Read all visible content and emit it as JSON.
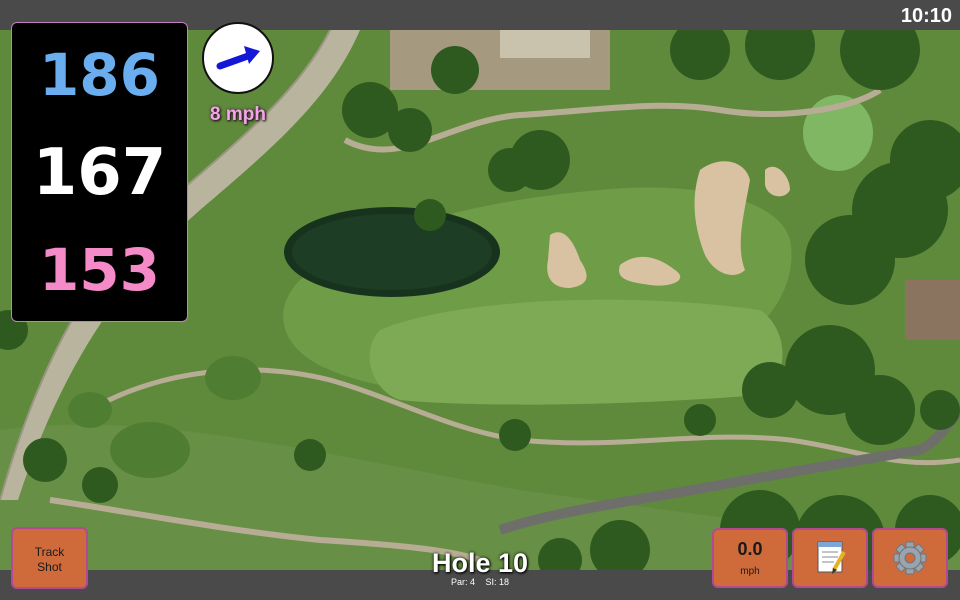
{
  "status": {
    "time": "10:10"
  },
  "distances": {
    "back": "186",
    "center": "167",
    "front": "153",
    "colors": {
      "back": "#6aaef0",
      "center": "#ffffff",
      "front": "#f58ac9"
    }
  },
  "wind": {
    "speed_label": "8 mph",
    "direction_icon": "arrow-icon"
  },
  "buttons": {
    "track_shot_line1": "Track",
    "track_shot_line2": "Shot",
    "wind_value": "0.0",
    "wind_unit": "mph",
    "notes_icon": "notepad-icon",
    "settings_icon": "gear-icon"
  },
  "hole": {
    "title": "Hole 10",
    "par": "Par: 4",
    "si": "SI: 18"
  }
}
